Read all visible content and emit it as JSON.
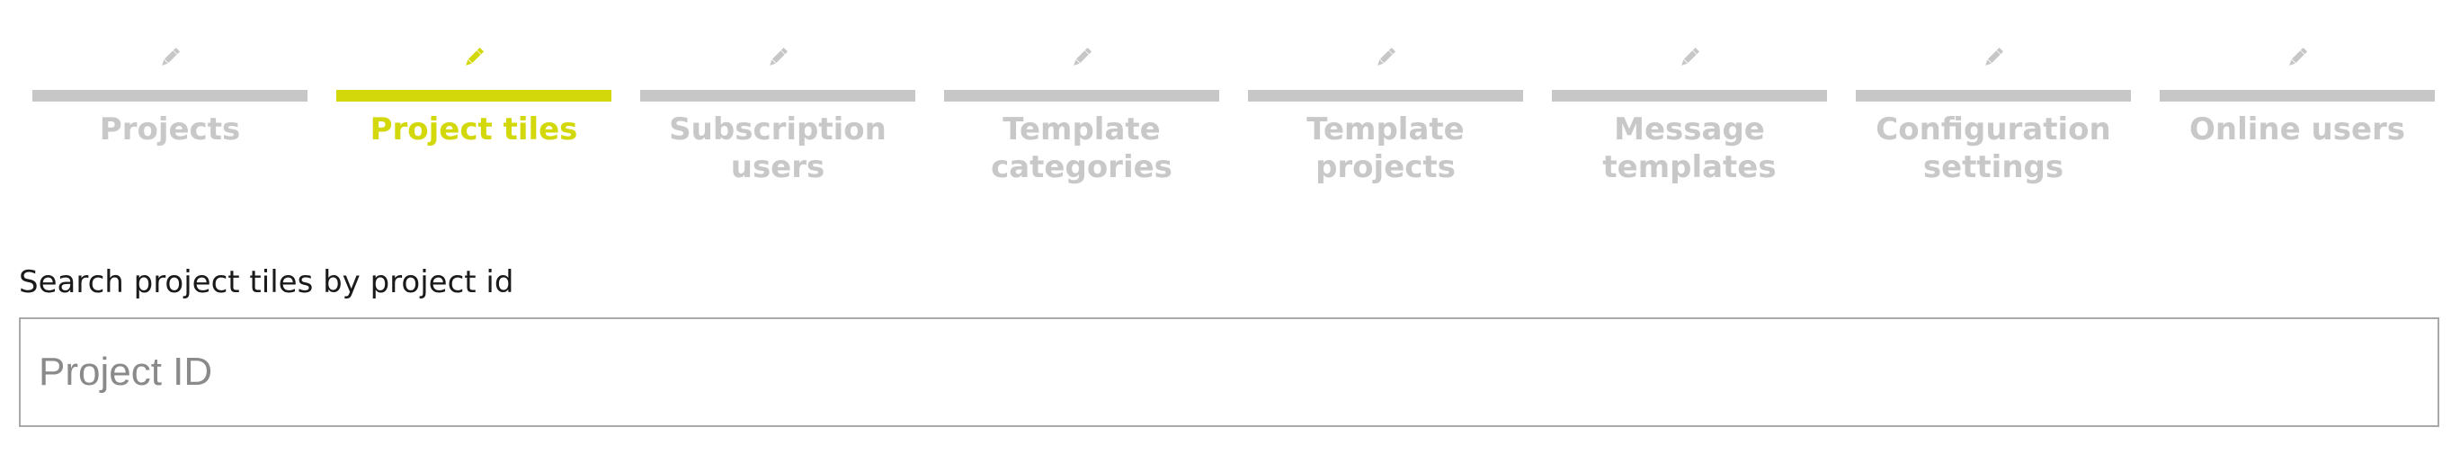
{
  "colors": {
    "active": "#d2d80a",
    "inactive": "#c7c7c7"
  },
  "tabs": [
    {
      "label": "Projects",
      "icon": "pencil-icon",
      "active": false
    },
    {
      "label": "Project tiles",
      "icon": "pencil-icon",
      "active": true
    },
    {
      "label": "Subscription users",
      "icon": "pencil-icon",
      "active": false
    },
    {
      "label": "Template categories",
      "icon": "pencil-icon",
      "active": false
    },
    {
      "label": "Template projects",
      "icon": "pencil-icon",
      "active": false
    },
    {
      "label": "Message templates",
      "icon": "pencil-icon",
      "active": false
    },
    {
      "label": "Configuration settings",
      "icon": "pencil-icon",
      "active": false
    },
    {
      "label": "Online users",
      "icon": "pencil-icon",
      "active": false
    }
  ],
  "search": {
    "label": "Search project tiles by project id",
    "placeholder": "Project ID",
    "value": ""
  }
}
